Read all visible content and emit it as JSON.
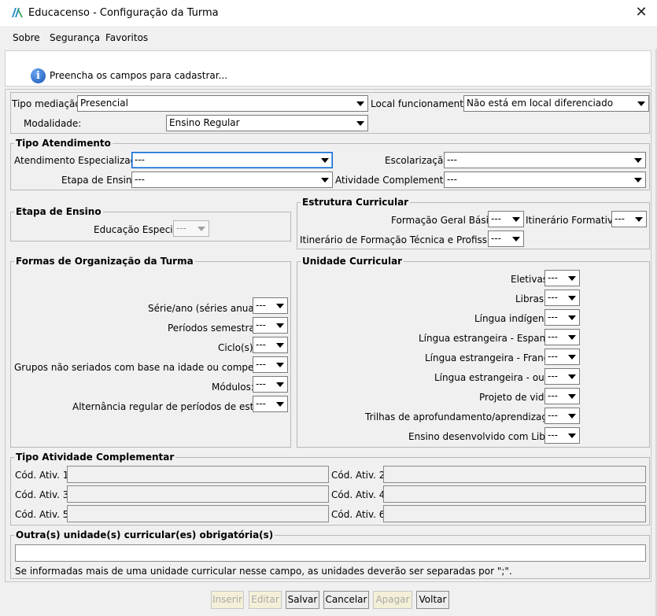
{
  "window": {
    "title": "Educacenso - Configuração da Turma",
    "close": "✕"
  },
  "menu": [
    "Sobre",
    "Segurança",
    "Favoritos"
  ],
  "info": {
    "text": "Preencha os campos para cadastrar..."
  },
  "top": {
    "tipo_mediacao_label": "Tipo mediação:",
    "tipo_mediacao_value": "Presencial",
    "local_label": "Local funcionamento:",
    "local_value": "Não está em local diferenciado",
    "modalidade_label": "Modalidade:",
    "modalidade_value": "Ensino Regular"
  },
  "tipo_atendimento": {
    "title": "Tipo Atendimento",
    "atendimento_label": "Atendimento Especializado:",
    "atendimento_value": "---",
    "escolarizacao_label": "Escolarização:",
    "escolarizacao_value": "---",
    "etapa_label": "Etapa de Ensino:",
    "etapa_value": "---",
    "atividade_label": "Atividade Complementar:",
    "atividade_value": "---"
  },
  "etapa_ensino": {
    "title": "Etapa de Ensino",
    "educacao_especial_label": "Educação Especial:",
    "educacao_especial_value": "---"
  },
  "estrutura": {
    "title": "Estrutura Curricular",
    "fgb_label": "Formação Geral Básica:",
    "fgb_value": "---",
    "itinerario_label": "Itinerário Formativo:",
    "itinerario_value": "---",
    "tecnica_label": "Itinerário de Formação Técnica e Profissional:",
    "tecnica_value": "---"
  },
  "formas": {
    "title": "Formas de Organização da Turma",
    "rows": [
      {
        "label": "Série/ano (séries anuais):",
        "value": "---"
      },
      {
        "label": "Períodos semestrais:",
        "value": "---"
      },
      {
        "label": "Ciclo(s):",
        "value": "---"
      },
      {
        "label": "Grupos não seriados com base na idade ou competência:",
        "value": "---"
      },
      {
        "label": "Módulos:",
        "value": "---"
      },
      {
        "label": "Alternância regular de períodos de estudos:",
        "value": "---"
      }
    ]
  },
  "unidade": {
    "title": "Unidade Curricular",
    "rows": [
      {
        "label": "Eletivas:",
        "value": "---"
      },
      {
        "label": "Libras:",
        "value": "---"
      },
      {
        "label": "Língua indígena:",
        "value": "---"
      },
      {
        "label": "Língua estrangeira - Espanhol:",
        "value": "---"
      },
      {
        "label": "Língua estrangeira - Francês:",
        "value": "---"
      },
      {
        "label": "Língua estrangeira - outra:",
        "value": "---"
      },
      {
        "label": "Projeto de vida:",
        "value": "---"
      },
      {
        "label": "Trilhas de aprofundamento/aprendizagens:",
        "value": "---"
      },
      {
        "label": "Ensino desenvolvido com Libras:",
        "value": "---"
      }
    ]
  },
  "atividade_complementar": {
    "title": "Tipo Atividade Complementar",
    "labels": [
      "Cód. Ativ. 1:",
      "Cód. Ativ. 2:",
      "Cód. Ativ. 3:",
      "Cód. Ativ. 4:",
      "Cód. Ativ. 5:",
      "Cód. Ativ. 6:"
    ],
    "values": [
      "",
      "",
      "",
      "",
      "",
      ""
    ]
  },
  "outras": {
    "title": "Outra(s) unidade(s) curricular(es) obrigatória(s)",
    "value": "",
    "hint": "Se informadas mais de uma unidade curricular nesse campo, as unidades deverão ser separadas por \";\"."
  },
  "buttons": {
    "inserir": "Inserir",
    "editar": "Editar",
    "salvar": "Salvar",
    "cancelar": "Cancelar",
    "apagar": "Apagar",
    "voltar": "Voltar"
  },
  "colors": {
    "accent_focus": "#0a64d6",
    "info_icon": "#1a55b6",
    "disabled_button_bg": "#f4f0d8"
  }
}
